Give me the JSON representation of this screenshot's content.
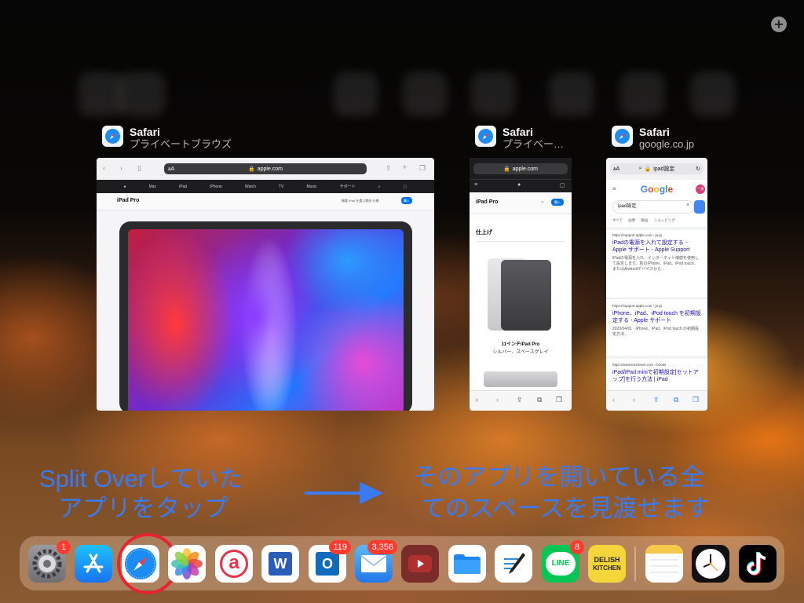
{
  "add_button": "+",
  "apps": [
    {
      "name": "Safari",
      "subtitle": "プライベートブラウズ"
    },
    {
      "name": "Safari",
      "subtitle": "プライベー…"
    },
    {
      "name": "Safari",
      "subtitle": "google.co.jp"
    }
  ],
  "card1": {
    "aa": "ᴀA",
    "url": "apple.com",
    "nav": [
      "",
      "Mac",
      "iPad",
      "iPhone",
      "Watch",
      "TV",
      "Music",
      "サポート"
    ],
    "title": "iPad Pro",
    "sublinks": "概要   iPad を選ぶ理由   仕様",
    "buy": "購入"
  },
  "card2": {
    "url": "apple.com",
    "title": "iPad Pro",
    "buy": "購入",
    "heading": "仕上げ",
    "caption1": "11インチiPad Pro",
    "caption2": "シルバー、スペースグレイ"
  },
  "card3": {
    "aa": "ᴀA",
    "url": "ipad設定",
    "google": "Google",
    "avatar": "一太",
    "search": "ipad設定",
    "tabs": "すべて  画像  動画  ショッピング",
    "results": [
      {
        "src": "https://support.apple.com › ja-jp",
        "title": "iPadの電源を入れて設定する - Apple サポート - Apple Support",
        "snippet": "iPadの電源を入れ、インターネット接続を使用して設定します。別のiPhone、iPad、iPod touch、またはAndroidデバイスから..."
      },
      {
        "src": "https://support.apple.com › ja-jp",
        "title": "iPhone、iPad、iPod touch を初期設定する - Apple サポート",
        "snippet": "2020/04/01 · iPhone、iPad、iPod touch の初期設定方法..."
      },
      {
        "src": "https://www.boxtravel.com › books",
        "title": "iPad/iPad miniで初期設定[セットアップ]を行う方法 | iPad",
        "snippet": ""
      }
    ]
  },
  "annotations": {
    "left_line1": "Split Overしていた",
    "left_line2": "アプリをタップ",
    "right_line1": "そのアプリを開いている全",
    "right_line2": "てのスペースを見渡せます"
  },
  "dock": {
    "badges": {
      "settings": "1",
      "outlook": "119",
      "mail": "3,356",
      "line": "8"
    },
    "word_label": "W",
    "outlook_label": "O",
    "line_label": "LINE",
    "delish_label1": "DELISH",
    "delish_label2": "KITCHEN",
    "ameba_label": "a"
  }
}
